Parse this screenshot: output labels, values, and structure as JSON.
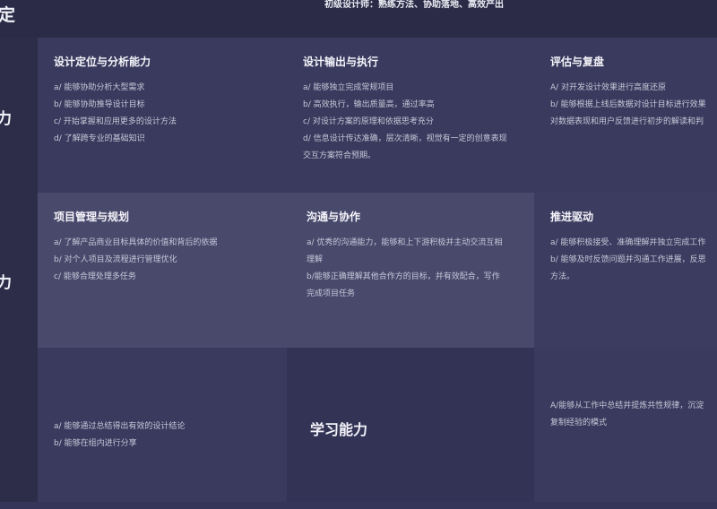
{
  "header": {
    "left_label": "定",
    "subtitle": "初级设计师：熟练方法、协助落地、高效产出"
  },
  "row_labels": [
    "力",
    "力"
  ],
  "rows": [
    [
      {
        "title": "设计定位与分析能力",
        "items": [
          "a/ 能够协助分析大型需求",
          "b/ 能够协助推导设计目标",
          "c/ 开始掌握和应用更多的设计方法",
          "d/ 了解跨专业的基础知识"
        ]
      },
      {
        "title": "设计输出与执行",
        "items": [
          "a/ 能够独立完成常规项目",
          "b/ 高效执行，输出质量高，通过率高",
          "c/ 对设计方案的原理和依据思考充分",
          "d/ 信息设计传达准确，层次清晰，视觉有一定的创意表现",
          "交互方案符合预期。"
        ]
      },
      {
        "title": "评估与复盘",
        "items": [
          "A/ 对开发设计效果进行高度还原",
          "b/ 能够根据上线后数据对设计目标进行效果",
          "对数据表现和用户反馈进行初步的解读和判"
        ]
      }
    ],
    [
      {
        "title": "项目管理与规划",
        "items": [
          "a/ 了解产品商业目标具体的价值和背后的依据",
          "b/ 对个人项目及流程进行管理优化",
          "c/ 能够合理处理多任务"
        ]
      },
      {
        "title": "沟通与协作",
        "items": [
          "a/ 优秀的沟通能力，能够和上下游积极并主动交流互相",
          "理解",
          "b/能够正确理解其他合作方的目标，并有效配合，写作",
          "完成项目任务"
        ]
      },
      {
        "title": "推进驱动",
        "items": [
          "a/ 能够积极接受、准确理解并独立完成工作",
          "b/ 能够及时反馈问题并沟通工作进展，反思",
          "方法。"
        ]
      }
    ]
  ],
  "row3": {
    "left_items": [
      "a/ 能够通过总结得出有效的设计结论",
      "b/ 能够在组内进行分享"
    ],
    "middle_title": "学习能力",
    "right_items": [
      "A/能够从工作中总结并提炼共性规律，沉淀",
      "复制经验的模式"
    ]
  },
  "colors": {
    "row1": "#3a3a5e",
    "row2": "#49496c",
    "row3": "#3a3a5e",
    "row3_mid": "#333356",
    "left_col": "#2d2d4a"
  }
}
